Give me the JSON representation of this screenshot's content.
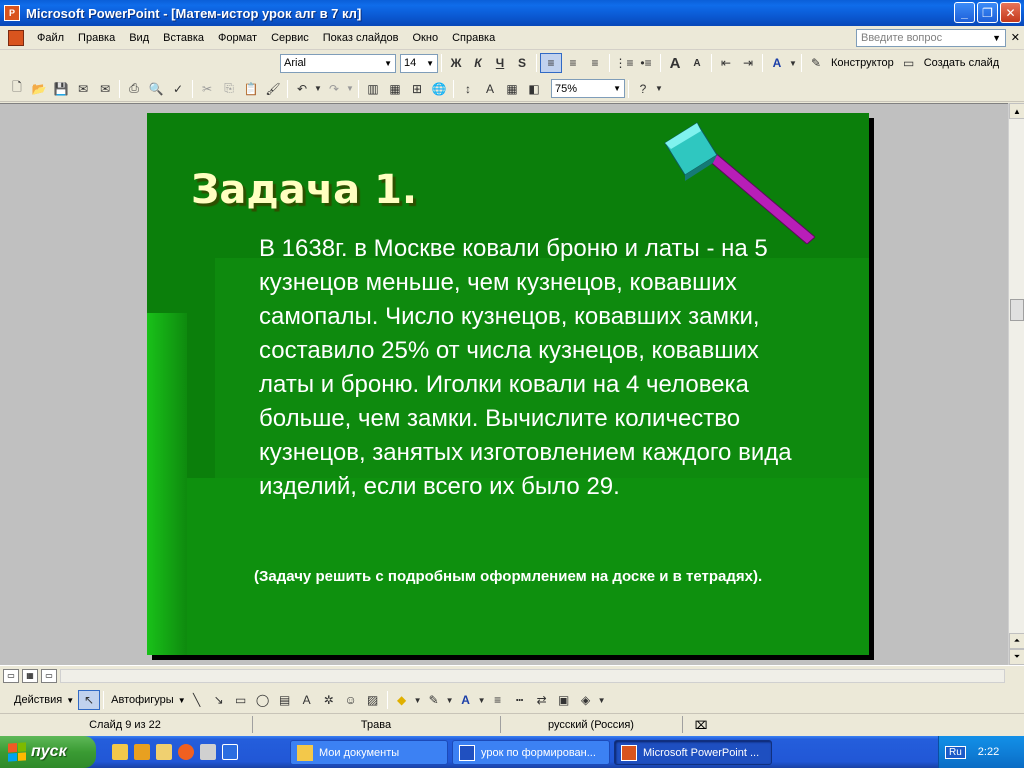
{
  "window": {
    "title": "Microsoft PowerPoint - [Матем-истор урок алг в 7 кл]",
    "controls": [
      "_",
      "❐",
      "✕"
    ]
  },
  "menu": {
    "items": [
      "Файл",
      "Правка",
      "Вид",
      "Вставка",
      "Формат",
      "Сервис",
      "Показ слайдов",
      "Окно",
      "Справка"
    ],
    "help_placeholder": "Введите вопрос"
  },
  "formatting": {
    "font": "Arial",
    "size": "14",
    "bold": "Ж",
    "italic": "К",
    "underline": "Ч",
    "shadow": "S",
    "designer": "Конструктор",
    "new_slide": "Создать слайд"
  },
  "standard": {
    "zoom": "75%"
  },
  "slide": {
    "heading": "Задача 1.",
    "body": "В 1638г. в Москве ковали броню и латы - на 5 кузнецов меньше, чем кузнецов, ковавших самопалы. Число кузнецов, ковавших замки, составило 25% от числа кузнецов, ковавших латы и броню. Иголки ковали на 4 человека больше, чем замки. Вычислите количество кузнецов, занятых изготовлением каждого вида изделий, если всего их было 29.",
    "note": "(Задачу решить с подробным оформлением на доске и в тетрадях).",
    "bg_color": "#0B7F0B"
  },
  "drawing": {
    "actions": "Действия",
    "autoshapes": "Автофигуры"
  },
  "status": {
    "slide": "Слайд 9 из 22",
    "design": "Трава",
    "language": "русский (Россия)"
  },
  "taskbar": {
    "start": "пуск",
    "tasks": [
      "Мои документы",
      "урок по формирован...",
      "Microsoft PowerPoint ..."
    ],
    "lang": "Ru",
    "clock": "2:22"
  }
}
